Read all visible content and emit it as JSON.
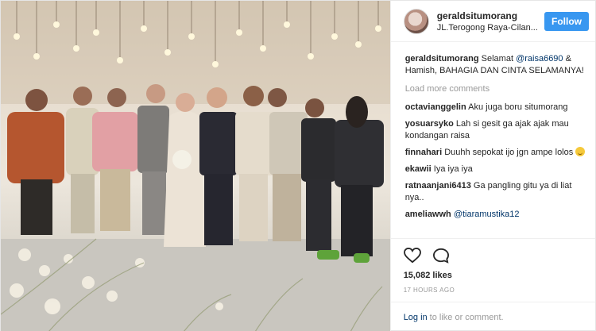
{
  "header": {
    "username": "geraldsitumorang",
    "location": "JL.Terogong Raya-Cilan...",
    "follow_label": "Follow"
  },
  "caption": {
    "username": "geraldsitumorang",
    "text_before": " Selamat ",
    "mention": "@raisa6690",
    "text_after": " & Hamish, BAHAGIA DAN CINTA SELAMANYA!"
  },
  "load_more": "Load more comments",
  "comments": [
    {
      "user": "octavianggelin",
      "text": " Aku juga boru situmorang"
    },
    {
      "user": "yosuarsyko",
      "text": " Lah si gesit ga ajak ajak mau kondangan raisa"
    },
    {
      "user": "finnahari",
      "text": " Duuhh sepokat ijo jgn ampe lolos "
    },
    {
      "user": "ekawii",
      "text": " Iya iya iya"
    },
    {
      "user": "ratnaanjani6413",
      "text": " Ga pangling gitu ya di liat nya.."
    },
    {
      "user": "ameliawwh",
      "text": " ",
      "mention": "@tiaramustika12"
    }
  ],
  "icons": {
    "like": "heart-icon",
    "comment": "comment-icon",
    "emoji": "grinning-face-emoji"
  },
  "likes": "15,082 likes",
  "time": "17 HOURS AGO",
  "login": {
    "link": "Log in",
    "text": "to like or comment."
  }
}
